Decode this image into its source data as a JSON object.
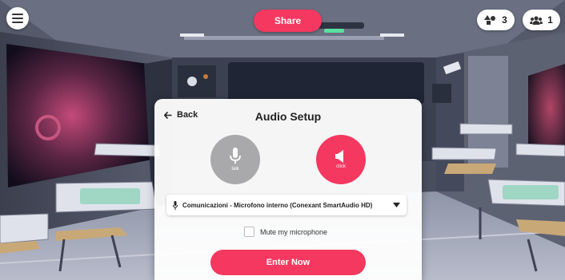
{
  "toolbar": {
    "menu_icon": "hamburger-menu-icon",
    "share_label": "Share",
    "objects_count": "3",
    "users_count": "1",
    "accent": "#f5385f"
  },
  "dialog": {
    "back_label": "Back",
    "title": "Audio Setup",
    "talk_label": "talk",
    "click_label": "click",
    "device_label": "Comunicazioni - Microfono interno (Conexant SmartAudio HD)",
    "mute_label": "Mute my microphone",
    "mute_checked": false,
    "enter_label": "Enter Now"
  }
}
